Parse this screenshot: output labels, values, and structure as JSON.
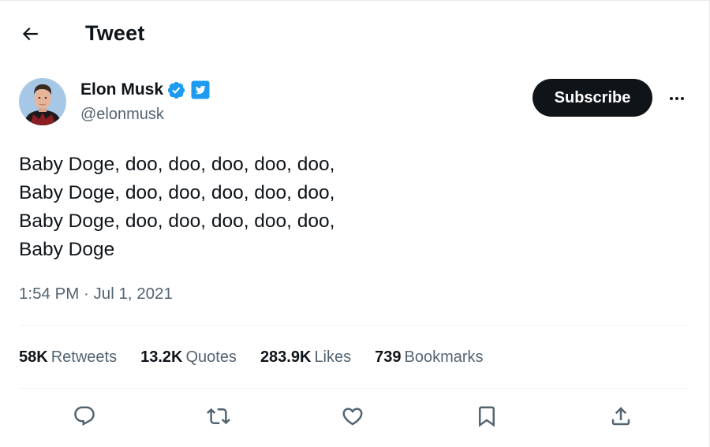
{
  "header": {
    "title": "Tweet"
  },
  "author": {
    "display_name": "Elon Musk",
    "handle": "@elonmusk"
  },
  "subscribe_label": "Subscribe",
  "tweet": {
    "lines": [
      "Baby Doge, doo, doo, doo, doo, doo,",
      "Baby Doge, doo, doo, doo, doo, doo,",
      "Baby Doge, doo, doo, doo, doo, doo,",
      "Baby Doge"
    ],
    "timestamp": "1:54 PM · Jul 1, 2021"
  },
  "stats": {
    "retweets": {
      "value": "58K",
      "label": "Retweets"
    },
    "quotes": {
      "value": "13.2K",
      "label": "Quotes"
    },
    "likes": {
      "value": "283.9K",
      "label": "Likes"
    },
    "bookmarks": {
      "value": "739",
      "label": "Bookmarks"
    }
  },
  "icons": {
    "back": "arrow-left-icon",
    "verified": "verified-badge-icon",
    "affiliate": "twitter-bird-badge-icon",
    "more": "more-horizontal-icon",
    "reply": "reply-icon",
    "retweet": "retweet-icon",
    "like": "heart-icon",
    "bookmark": "bookmark-icon",
    "share": "share-icon"
  },
  "colors": {
    "text": "#0f1419",
    "secondary_text": "#536471",
    "verified_blue": "#1d9bf0",
    "divider": "#eff3f4",
    "button_dark": "#0f1419"
  }
}
